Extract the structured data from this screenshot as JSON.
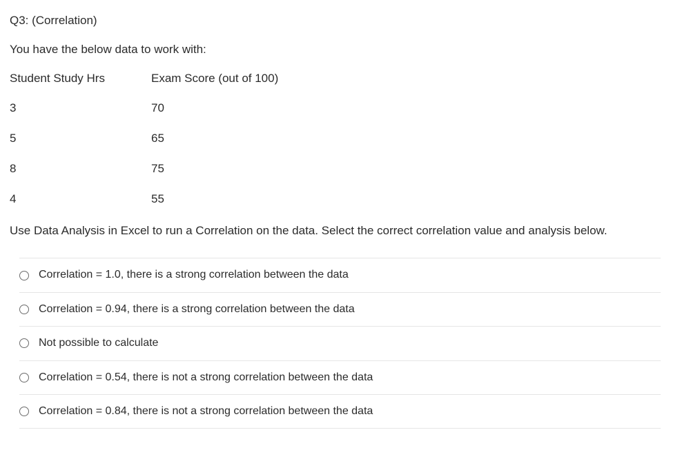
{
  "question_label": "Q3: (Correlation)",
  "intro_text": "You have the below data to work with:",
  "table": {
    "headers": {
      "col1": "Student Study Hrs",
      "col2": "Exam Score (out of 100)"
    },
    "rows": [
      {
        "col1": "3",
        "col2": "70"
      },
      {
        "col1": "5",
        "col2": "65"
      },
      {
        "col1": "8",
        "col2": "75"
      },
      {
        "col1": "4",
        "col2": "55"
      }
    ]
  },
  "instruction_text": "Use Data Analysis in Excel to run a Correlation on the data.  Select the correct correlation value and analysis below.",
  "options": [
    {
      "label": "Correlation = 1.0, there is a strong correlation between the data"
    },
    {
      "label": "Correlation = 0.94, there is a strong correlation between the data"
    },
    {
      "label": "Not possible to calculate"
    },
    {
      "label": "Correlation = 0.54, there is not a strong correlation between the data"
    },
    {
      "label": "Correlation = 0.84, there is not a strong correlation between the data"
    }
  ]
}
